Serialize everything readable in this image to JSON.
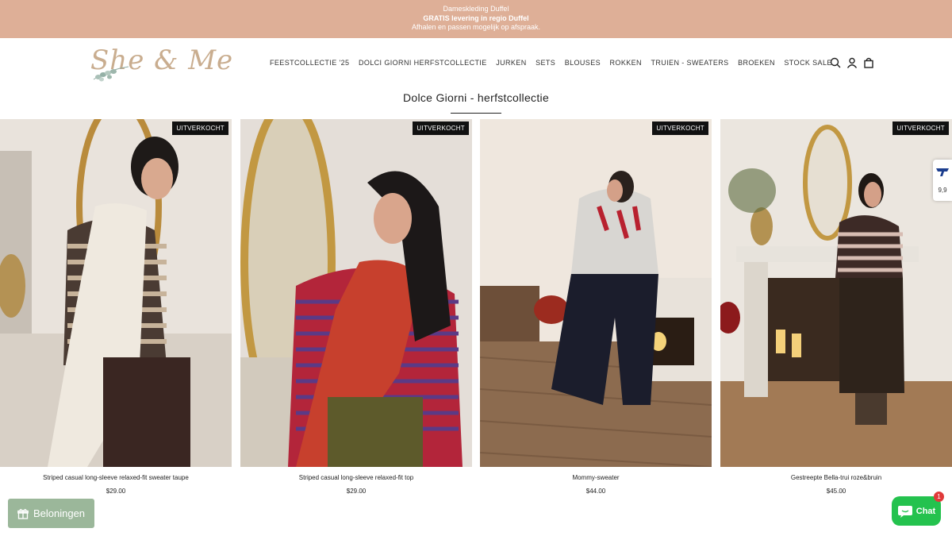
{
  "announcement": {
    "line1": "Dameskleding Duffel",
    "line2": "GRATIS levering in regio Duffel",
    "line3": "Afhalen en passen mogelijk op afspraak."
  },
  "logo": {
    "text": "She & Me"
  },
  "nav": {
    "items": [
      "FEESTCOLLECTIE '25",
      "DOLCI GIORNI HERFSTCOLLECTIE",
      "JURKEN",
      "SETS",
      "BLOUSES",
      "ROKKEN",
      "TRUIEN - SWEATERS",
      "BROEKEN",
      "STOCK SALE"
    ]
  },
  "header_icons": [
    "search-icon",
    "account-icon",
    "cart-icon"
  ],
  "collection": {
    "title": "Dolce Giorni - herfstcollectie"
  },
  "products": [
    {
      "name": "Striped casual long-sleeve relaxed-fit sweater taupe",
      "price": "$29.00",
      "badge": "UITVERKOCHT"
    },
    {
      "name": "Striped casual long-sleeve relaxed-fit top",
      "price": "$29.00",
      "badge": "UITVERKOCHT"
    },
    {
      "name": "Mommy-sweater",
      "price": "$44.00",
      "badge": "UITVERKOCHT"
    },
    {
      "name": "Gestreepte Bella-trui roze&bruin",
      "price": "$45.00",
      "badge": "UITVERKOCHT"
    }
  ],
  "rewards": {
    "label": "Beloningen"
  },
  "chat": {
    "label": "Chat",
    "count": "1"
  },
  "trust_badge": {
    "score": "9,9"
  },
  "colors": {
    "announcement_bg": "#deaf97",
    "rewards_bg": "#9bb79a",
    "chat_bg": "#24c24e",
    "badge_bg": "#111111"
  }
}
